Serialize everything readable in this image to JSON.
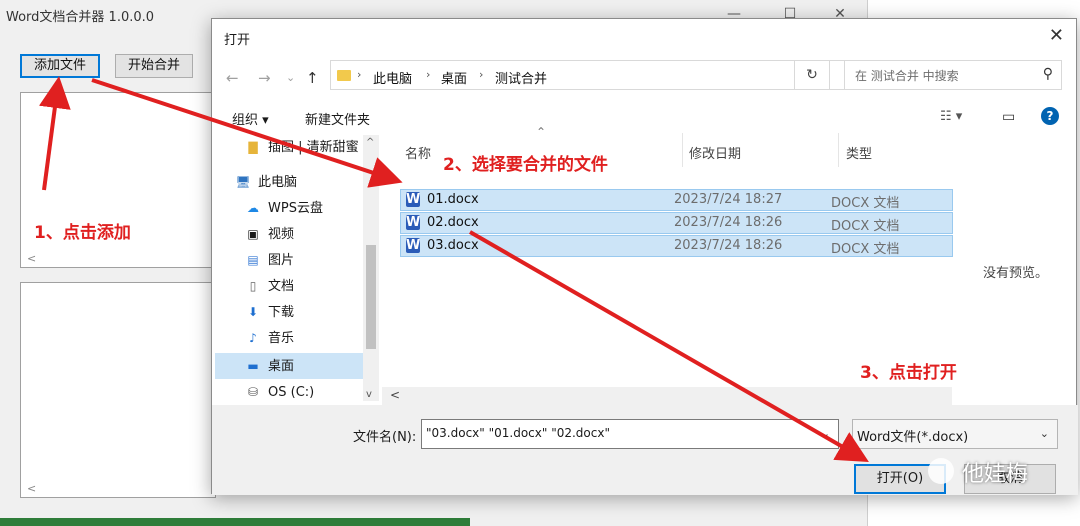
{
  "app": {
    "title": "Word文档合并器 1.0.0.0",
    "buttons": {
      "add": "添加文件",
      "merge": "开始合并"
    },
    "win_min": "—",
    "win_max": "☐",
    "win_close": "✕"
  },
  "dialog": {
    "title": "打开",
    "close": "✕",
    "nav": {
      "back": "←",
      "forward": "→",
      "history": "⌄",
      "up": "↑"
    },
    "breadcrumb": [
      "此电脑",
      "桌面",
      "测试合并"
    ],
    "search_placeholder": "在 测试合并 中搜索",
    "toolbar": {
      "organize": "组织 ▾",
      "new_folder": "新建文件夹"
    },
    "nav_items": [
      {
        "label": "插图 | 清新甜蜜",
        "icon": "folder-icon"
      },
      {
        "label": "此电脑",
        "icon": "computer-icon"
      },
      {
        "label": "WPS云盘",
        "icon": "cloud-icon"
      },
      {
        "label": "视频",
        "icon": "video-icon"
      },
      {
        "label": "图片",
        "icon": "picture-icon"
      },
      {
        "label": "文档",
        "icon": "document-icon"
      },
      {
        "label": "下载",
        "icon": "download-icon"
      },
      {
        "label": "音乐",
        "icon": "music-icon"
      },
      {
        "label": "桌面",
        "icon": "desktop-icon"
      },
      {
        "label": "OS (C:)",
        "icon": "drive-icon"
      }
    ],
    "columns": {
      "name": "名称",
      "modified": "修改日期",
      "type": "类型"
    },
    "files": [
      {
        "name": "01.docx",
        "date": "2023/7/24 18:27",
        "type": "DOCX 文档"
      },
      {
        "name": "02.docx",
        "date": "2023/7/24 18:26",
        "type": "DOCX 文档"
      },
      {
        "name": "03.docx",
        "date": "2023/7/24 18:26",
        "type": "DOCX 文档"
      }
    ],
    "preview_text": "没有预览。",
    "filename_label": "文件名(N):",
    "filename_value": "\"03.docx\" \"01.docx\" \"02.docx\"",
    "filetype_value": "Word文件(*.docx)",
    "open_button": "打开(O)",
    "cancel_button": "取消"
  },
  "annotations": {
    "step1": "1、点击添加",
    "step2": "2、选择要合并的文件",
    "step3": "3、点击打开",
    "color": "#e02020"
  },
  "watermark": "他娃梅"
}
